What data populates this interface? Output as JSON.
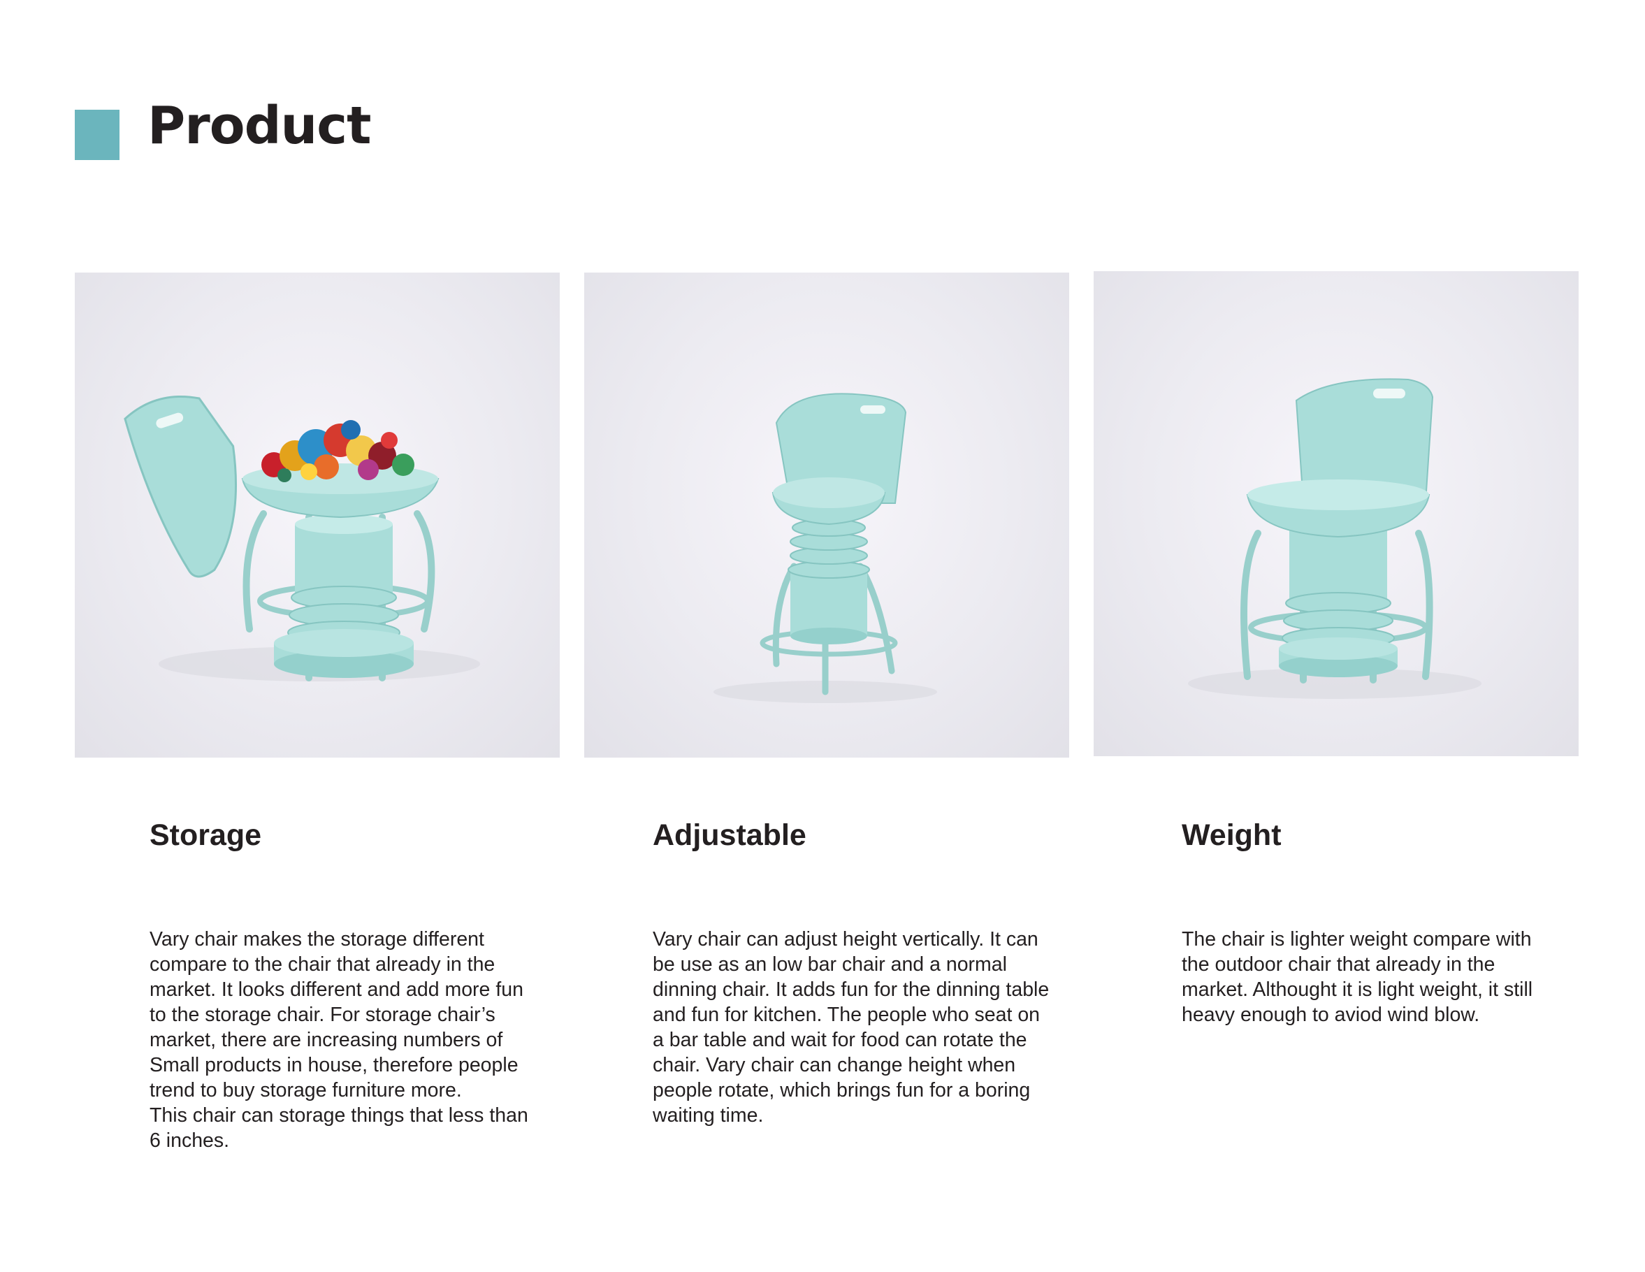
{
  "page": {
    "title": "Product",
    "accent_color": "#6bb5bd"
  },
  "features": [
    {
      "heading": "Storage",
      "text": "Vary chair makes the storage different\ncompare to the chair that already in the\nmarket. It looks different and add more fun\nto the storage chair. For storage chair’s\nmarket, there are increasing numbers of\nSmall products in house, therefore people\ntrend to buy storage furniture more.\nThis chair can storage things that less than\n6 inches.",
      "image": "chair-open-with-toys"
    },
    {
      "heading": "Adjustable",
      "text": "Vary chair can adjust height vertically. It can\nbe use as an low bar chair and a normal\ndinning chair. It adds fun for the dinning table\nand fun for kitchen. The people who seat on\na bar table and wait for food can rotate the\nchair. Vary chair can change height when\npeople rotate, which brings fun for a boring\nwaiting time.",
      "image": "chair-raised"
    },
    {
      "heading": "Weight",
      "text": "The chair is lighter weight compare with\nthe outdoor chair that already in the\nmarket. Althought it is light weight, it still\nheavy enough to aviod wind blow.",
      "image": "chair-front"
    }
  ],
  "colors": {
    "chair": "#a9ddd9",
    "chair_shade": "#86c5c1",
    "metal": "#98cfcb"
  }
}
